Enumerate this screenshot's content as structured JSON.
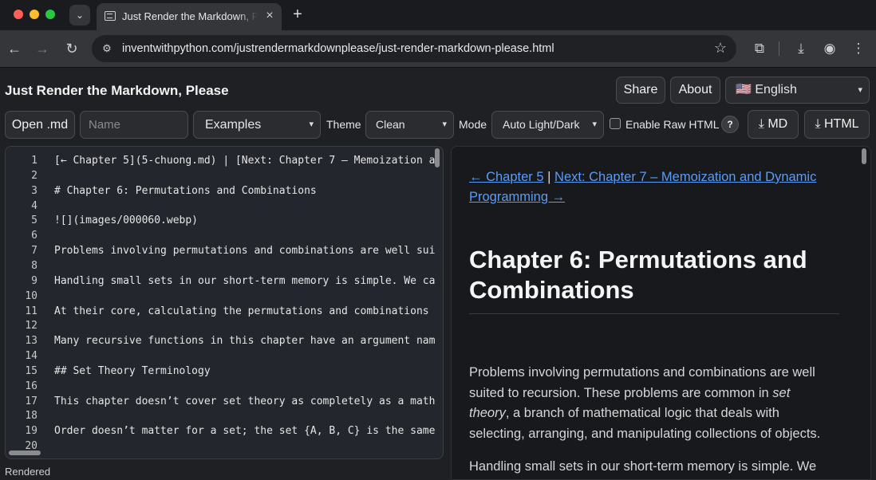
{
  "browser": {
    "tab_title": "Just Render the Markdown, Please",
    "url": "inventwithpython.com/justrendermarkdownplease/just-render-markdown-please.html"
  },
  "header": {
    "title": "Just Render the Markdown, Please",
    "share_label": "Share",
    "about_label": "About",
    "language": "🇺🇸 English"
  },
  "controls": {
    "open_label": "Open .md",
    "name_placeholder": "Name",
    "examples_label": "Examples",
    "theme_label": "Theme",
    "theme_value": "Clean",
    "mode_label": "Mode",
    "mode_value": "Auto Light/Dark",
    "raw_html_label": "Enable Raw HTML",
    "help_label": "?",
    "md_label": "MD",
    "html_label": "HTML"
  },
  "editor": {
    "lines": [
      {
        "n": "1",
        "text": "[← Chapter 5](5-chuong.md) | [Next: Chapter 7 – Memoization a"
      },
      {
        "n": "2",
        "text": ""
      },
      {
        "n": "3",
        "text": "# Chapter 6: Permutations and Combinations"
      },
      {
        "n": "4",
        "text": ""
      },
      {
        "n": "5",
        "text": "![](images/000060.webp)"
      },
      {
        "n": "6",
        "text": ""
      },
      {
        "n": "7",
        "text": "Problems involving permutations and combinations are well sui"
      },
      {
        "n": "8",
        "text": ""
      },
      {
        "n": "9",
        "text": "Handling small sets in our short-term memory is simple. We ca"
      },
      {
        "n": "10",
        "text": ""
      },
      {
        "n": "11",
        "text": "At their core, calculating the permutations and combinations"
      },
      {
        "n": "12",
        "text": ""
      },
      {
        "n": "13",
        "text": "Many recursive functions in this chapter have an argument nam"
      },
      {
        "n": "14",
        "text": ""
      },
      {
        "n": "15",
        "text": "## Set Theory Terminology"
      },
      {
        "n": "16",
        "text": ""
      },
      {
        "n": "17",
        "text": "This chapter doesn’t cover set theory as completely as a math"
      },
      {
        "n": "18",
        "text": ""
      },
      {
        "n": "19",
        "text": "Order doesn’t matter for a set; the set {A, B, C} is the same"
      },
      {
        "n": "20",
        "text": ""
      }
    ]
  },
  "preview": {
    "prev_link": "← Chapter 5",
    "separator": "|",
    "next_link": "Next: Chapter 7 – Memoization and Dynamic Programming →",
    "heading": "Chapter 6: Permutations and Combinations",
    "p1_a": "Problems involving permutations and combinations are well suited to recursion. These problems are common in ",
    "p1_em": "set theory",
    "p1_b": ", a branch of mathematical logic that deals with selecting, arranging, and manipulating collections of objects.",
    "p2": "Handling small sets in our short-term memory is simple. We can"
  },
  "status": "Rendered"
}
